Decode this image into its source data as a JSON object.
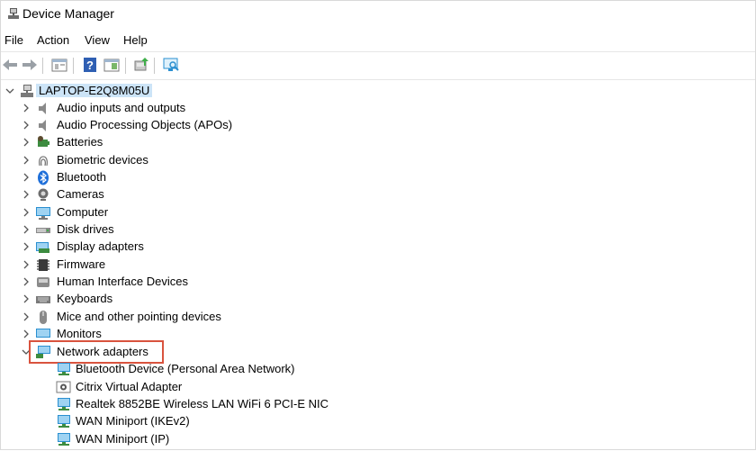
{
  "window": {
    "title": "Device Manager"
  },
  "menubar": {
    "items": [
      "File",
      "Action",
      "View",
      "Help"
    ]
  },
  "toolbar": {
    "buttons": [
      "back-arrow-icon",
      "forward-arrow-icon",
      "properties-icon",
      "help-icon",
      "action-pane-icon",
      "update-driver-icon",
      "scan-hardware-icon"
    ]
  },
  "tree": {
    "root": "LAPTOP-E2Q8M05U",
    "categories": [
      "Audio inputs and outputs",
      "Audio Processing Objects (APOs)",
      "Batteries",
      "Biometric devices",
      "Bluetooth",
      "Cameras",
      "Computer",
      "Disk drives",
      "Display adapters",
      "Firmware",
      "Human Interface Devices",
      "Keyboards",
      "Mice and other pointing devices",
      "Monitors",
      "Network adapters"
    ],
    "expanded_category": "Network adapters",
    "network_adapters": [
      "Bluetooth Device (Personal Area Network)",
      "Citrix Virtual Adapter",
      "Realtek 8852BE Wireless LAN WiFi 6 PCI-E NIC",
      "WAN Miniport (IKEv2)",
      "WAN Miniport (IP)"
    ]
  },
  "colors": {
    "highlight_border": "#d9533e",
    "selection": "#cce4f7"
  }
}
